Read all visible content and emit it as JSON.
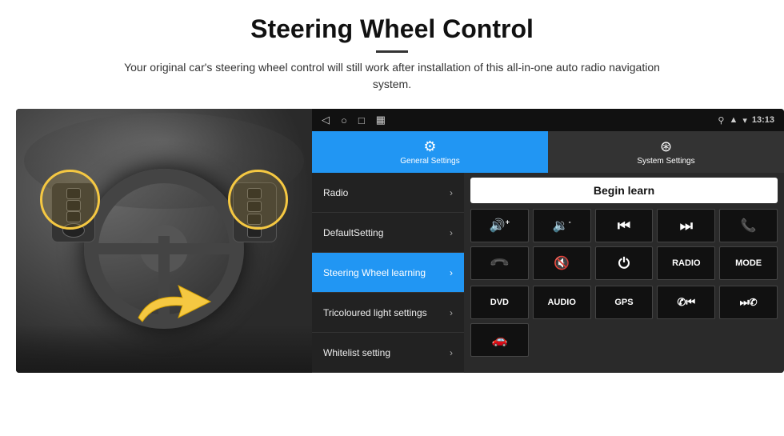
{
  "header": {
    "title": "Steering Wheel Control",
    "subtitle": "Your original car's steering wheel control will still work after installation of this all-in-one auto radio navigation system."
  },
  "android": {
    "status_bar": {
      "nav_back": "◁",
      "nav_home": "○",
      "nav_recent": "□",
      "nav_extra": "▦",
      "signal_icon": "▲",
      "wifi_icon": "▾",
      "time": "13:13"
    },
    "tabs": [
      {
        "id": "general",
        "label": "General Settings",
        "active": true
      },
      {
        "id": "system",
        "label": "System Settings",
        "active": false
      }
    ],
    "menu_items": [
      {
        "id": "radio",
        "label": "Radio",
        "active": false
      },
      {
        "id": "defaultsetting",
        "label": "DefaultSetting",
        "active": false
      },
      {
        "id": "steering",
        "label": "Steering Wheel learning",
        "active": true
      },
      {
        "id": "tricoloured",
        "label": "Tricoloured light settings",
        "active": false
      },
      {
        "id": "whitelist",
        "label": "Whitelist setting",
        "active": false
      }
    ],
    "begin_learn_label": "Begin learn",
    "control_buttons_row1": [
      {
        "id": "vol_up",
        "icon": "🔊+",
        "symbol": "◀◀+"
      },
      {
        "id": "vol_down",
        "icon": "🔉-",
        "symbol": "◀◀-"
      },
      {
        "id": "prev",
        "icon": "|◀◀",
        "symbol": "⏮"
      },
      {
        "id": "next",
        "icon": "▶▶|",
        "symbol": "⏭"
      },
      {
        "id": "phone",
        "icon": "📞",
        "symbol": "✆"
      }
    ],
    "control_buttons_row2": [
      {
        "id": "hook",
        "icon": "↩",
        "symbol": "↩"
      },
      {
        "id": "mute",
        "icon": "🔇",
        "symbol": "🔇"
      },
      {
        "id": "power",
        "icon": "⏻",
        "symbol": "⏻"
      },
      {
        "id": "radio_btn",
        "label": "RADIO"
      },
      {
        "id": "mode_btn",
        "label": "MODE"
      }
    ],
    "control_buttons_row3": [
      {
        "id": "dvd",
        "label": "DVD"
      },
      {
        "id": "audio",
        "label": "AUDIO"
      },
      {
        "id": "gps",
        "label": "GPS"
      },
      {
        "id": "tel_prev",
        "symbol": "✆⏮"
      },
      {
        "id": "tel_next",
        "symbol": "⏭✆"
      }
    ]
  }
}
